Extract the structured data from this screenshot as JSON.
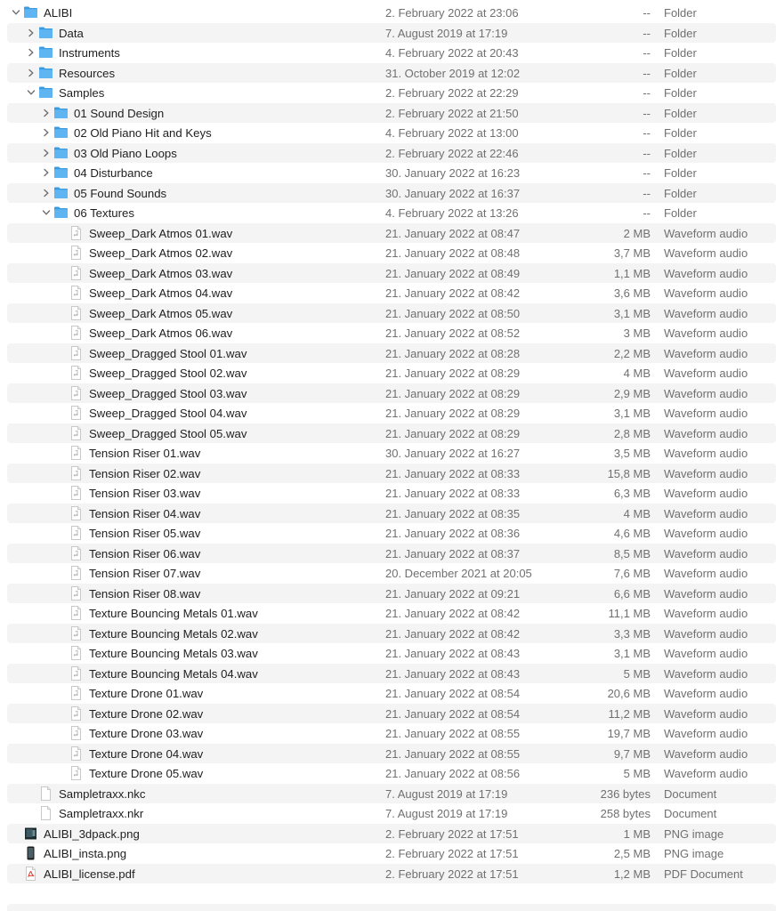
{
  "rows": [
    {
      "name": "ALIBI",
      "date": "2. February 2022 at 23:06",
      "size": "--",
      "kind": "Folder",
      "level": 0,
      "type": "folder",
      "expanded": true
    },
    {
      "name": "Data",
      "date": "7. August 2019 at 17:19",
      "size": "--",
      "kind": "Folder",
      "level": 1,
      "type": "folder",
      "expanded": false
    },
    {
      "name": "Instruments",
      "date": "4. February 2022 at 20:43",
      "size": "--",
      "kind": "Folder",
      "level": 1,
      "type": "folder",
      "expanded": false
    },
    {
      "name": "Resources",
      "date": "31. October 2019 at 12:02",
      "size": "--",
      "kind": "Folder",
      "level": 1,
      "type": "folder",
      "expanded": false
    },
    {
      "name": "Samples",
      "date": "2. February 2022 at 22:29",
      "size": "--",
      "kind": "Folder",
      "level": 1,
      "type": "folder",
      "expanded": true
    },
    {
      "name": "01 Sound Design",
      "date": "2. February 2022 at 21:50",
      "size": "--",
      "kind": "Folder",
      "level": 2,
      "type": "folder",
      "expanded": false
    },
    {
      "name": "02 Old Piano Hit and Keys",
      "date": "4. February 2022 at 13:00",
      "size": "--",
      "kind": "Folder",
      "level": 2,
      "type": "folder",
      "expanded": false
    },
    {
      "name": "03 Old Piano Loops",
      "date": "2. February 2022 at 22:46",
      "size": "--",
      "kind": "Folder",
      "level": 2,
      "type": "folder",
      "expanded": false
    },
    {
      "name": "04 Disturbance",
      "date": "30. January 2022 at 16:23",
      "size": "--",
      "kind": "Folder",
      "level": 2,
      "type": "folder",
      "expanded": false
    },
    {
      "name": "05 Found Sounds",
      "date": "30. January 2022 at 16:37",
      "size": "--",
      "kind": "Folder",
      "level": 2,
      "type": "folder",
      "expanded": false
    },
    {
      "name": "06 Textures",
      "date": "4. February 2022 at 13:26",
      "size": "--",
      "kind": "Folder",
      "level": 2,
      "type": "folder",
      "expanded": true
    },
    {
      "name": "Sweep_Dark Atmos 01.wav",
      "date": "21. January 2022 at 08:47",
      "size": "2 MB",
      "kind": "Waveform audio",
      "level": 3,
      "type": "audio"
    },
    {
      "name": "Sweep_Dark Atmos 02.wav",
      "date": "21. January 2022 at 08:48",
      "size": "3,7 MB",
      "kind": "Waveform audio",
      "level": 3,
      "type": "audio"
    },
    {
      "name": "Sweep_Dark Atmos 03.wav",
      "date": "21. January 2022 at 08:49",
      "size": "1,1 MB",
      "kind": "Waveform audio",
      "level": 3,
      "type": "audio"
    },
    {
      "name": "Sweep_Dark Atmos 04.wav",
      "date": "21. January 2022 at 08:42",
      "size": "3,6 MB",
      "kind": "Waveform audio",
      "level": 3,
      "type": "audio"
    },
    {
      "name": "Sweep_Dark Atmos 05.wav",
      "date": "21. January 2022 at 08:50",
      "size": "3,1 MB",
      "kind": "Waveform audio",
      "level": 3,
      "type": "audio"
    },
    {
      "name": "Sweep_Dark Atmos 06.wav",
      "date": "21. January 2022 at 08:52",
      "size": "3 MB",
      "kind": "Waveform audio",
      "level": 3,
      "type": "audio"
    },
    {
      "name": "Sweep_Dragged Stool 01.wav",
      "date": "21. January 2022 at 08:28",
      "size": "2,2 MB",
      "kind": "Waveform audio",
      "level": 3,
      "type": "audio"
    },
    {
      "name": "Sweep_Dragged Stool 02.wav",
      "date": "21. January 2022 at 08:29",
      "size": "4 MB",
      "kind": "Waveform audio",
      "level": 3,
      "type": "audio"
    },
    {
      "name": "Sweep_Dragged Stool 03.wav",
      "date": "21. January 2022 at 08:29",
      "size": "2,9 MB",
      "kind": "Waveform audio",
      "level": 3,
      "type": "audio"
    },
    {
      "name": "Sweep_Dragged Stool 04.wav",
      "date": "21. January 2022 at 08:29",
      "size": "3,1 MB",
      "kind": "Waveform audio",
      "level": 3,
      "type": "audio"
    },
    {
      "name": "Sweep_Dragged Stool 05.wav",
      "date": "21. January 2022 at 08:29",
      "size": "2,8 MB",
      "kind": "Waveform audio",
      "level": 3,
      "type": "audio"
    },
    {
      "name": "Tension Riser 01.wav",
      "date": "30. January 2022 at 16:27",
      "size": "3,5 MB",
      "kind": "Waveform audio",
      "level": 3,
      "type": "audio"
    },
    {
      "name": "Tension Riser 02.wav",
      "date": "21. January 2022 at 08:33",
      "size": "15,8 MB",
      "kind": "Waveform audio",
      "level": 3,
      "type": "audio"
    },
    {
      "name": "Tension Riser 03.wav",
      "date": "21. January 2022 at 08:33",
      "size": "6,3 MB",
      "kind": "Waveform audio",
      "level": 3,
      "type": "audio"
    },
    {
      "name": "Tension Riser 04.wav",
      "date": "21. January 2022 at 08:35",
      "size": "4 MB",
      "kind": "Waveform audio",
      "level": 3,
      "type": "audio"
    },
    {
      "name": "Tension Riser 05.wav",
      "date": "21. January 2022 at 08:36",
      "size": "4,6 MB",
      "kind": "Waveform audio",
      "level": 3,
      "type": "audio"
    },
    {
      "name": "Tension Riser 06.wav",
      "date": "21. January 2022 at 08:37",
      "size": "8,5 MB",
      "kind": "Waveform audio",
      "level": 3,
      "type": "audio"
    },
    {
      "name": "Tension Riser 07.wav",
      "date": "20. December 2021 at 20:05",
      "size": "7,6 MB",
      "kind": "Waveform audio",
      "level": 3,
      "type": "audio"
    },
    {
      "name": "Tension Riser 08.wav",
      "date": "21. January 2022 at 09:21",
      "size": "6,6 MB",
      "kind": "Waveform audio",
      "level": 3,
      "type": "audio"
    },
    {
      "name": "Texture Bouncing Metals 01.wav",
      "date": "21. January 2022 at 08:42",
      "size": "11,1 MB",
      "kind": "Waveform audio",
      "level": 3,
      "type": "audio"
    },
    {
      "name": "Texture Bouncing Metals 02.wav",
      "date": "21. January 2022 at 08:42",
      "size": "3,3 MB",
      "kind": "Waveform audio",
      "level": 3,
      "type": "audio"
    },
    {
      "name": "Texture Bouncing Metals 03.wav",
      "date": "21. January 2022 at 08:43",
      "size": "3,1 MB",
      "kind": "Waveform audio",
      "level": 3,
      "type": "audio"
    },
    {
      "name": "Texture Bouncing Metals 04.wav",
      "date": "21. January 2022 at 08:43",
      "size": "5 MB",
      "kind": "Waveform audio",
      "level": 3,
      "type": "audio"
    },
    {
      "name": "Texture Drone 01.wav",
      "date": "21. January 2022 at 08:54",
      "size": "20,6 MB",
      "kind": "Waveform audio",
      "level": 3,
      "type": "audio"
    },
    {
      "name": "Texture Drone 02.wav",
      "date": "21. January 2022 at 08:54",
      "size": "11,2 MB",
      "kind": "Waveform audio",
      "level": 3,
      "type": "audio"
    },
    {
      "name": "Texture Drone 03.wav",
      "date": "21. January 2022 at 08:55",
      "size": "19,7 MB",
      "kind": "Waveform audio",
      "level": 3,
      "type": "audio"
    },
    {
      "name": "Texture Drone 04.wav",
      "date": "21. January 2022 at 08:55",
      "size": "9,7 MB",
      "kind": "Waveform audio",
      "level": 3,
      "type": "audio"
    },
    {
      "name": "Texture Drone 05.wav",
      "date": "21. January 2022 at 08:56",
      "size": "5 MB",
      "kind": "Waveform audio",
      "level": 3,
      "type": "audio"
    },
    {
      "name": "Sampletraxx.nkc",
      "date": "7. August 2019 at 17:19",
      "size": "236 bytes",
      "kind": "Document",
      "level": 1,
      "type": "document"
    },
    {
      "name": "Sampletraxx.nkr",
      "date": "7. August 2019 at 17:19",
      "size": "258 bytes",
      "kind": "Document",
      "level": 1,
      "type": "document"
    },
    {
      "name": "ALIBI_3dpack.png",
      "date": "2. February 2022 at 17:51",
      "size": "1 MB",
      "kind": "PNG image",
      "level": 0,
      "type": "image-dark"
    },
    {
      "name": "ALIBI_insta.png",
      "date": "2. February 2022 at 17:51",
      "size": "2,5 MB",
      "kind": "PNG image",
      "level": 0,
      "type": "image-phone"
    },
    {
      "name": "ALIBI_license.pdf",
      "date": "2. February 2022 at 17:51",
      "size": "1,2 MB",
      "kind": "PDF Document",
      "level": 0,
      "type": "pdf"
    }
  ],
  "icon_names": {
    "folder": "folder-icon",
    "audio": "audio-file-icon",
    "document": "document-icon",
    "image-dark": "image-thumbnail-icon",
    "image-phone": "image-thumbnail-icon",
    "pdf": "pdf-icon"
  },
  "colors": {
    "folder_blue": "#5eb5f2",
    "folder_blue_dark": "#3b9be0",
    "stripe": "#f4f4f4",
    "text_primary": "#1f1f1f",
    "text_secondary": "#707070",
    "pdf_red": "#d93a2b"
  }
}
